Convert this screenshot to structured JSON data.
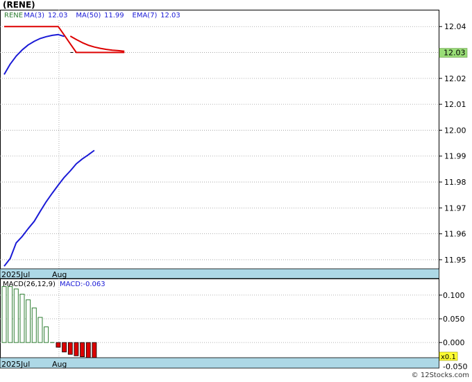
{
  "chart_data": [
    {
      "type": "line",
      "title": "(RENE)",
      "legend": [
        {
          "label": "RENE",
          "color": "#2e7d32"
        },
        {
          "label": "MA(3)",
          "value": "12.03",
          "color": "#1a1ad6"
        },
        {
          "label": "MA(50)",
          "value": "11.99",
          "color": "#1a1ad6"
        },
        {
          "label": "EMA(7)",
          "value": "12.03",
          "color": "#1a1ad6"
        }
      ],
      "x_labels": [
        "2025Jul",
        "Aug"
      ],
      "yticks": [
        11.95,
        11.96,
        11.97,
        11.98,
        11.99,
        12.0,
        12.01,
        12.02,
        12.03,
        12.04
      ],
      "ylim": [
        11.9465,
        12.0465
      ],
      "last_price_label": "12.03",
      "last_price_color": "#99dd77",
      "grid": true,
      "series": [
        {
          "key": "price",
          "color": "#000000",
          "dashed": true,
          "points": [
            [
              11,
              12.03
            ],
            [
              20,
              12.03
            ]
          ]
        },
        {
          "key": "ma3",
          "color": "#dd0000",
          "points": [
            [
              0,
              12.04
            ],
            [
              1,
              12.04
            ],
            [
              2,
              12.04
            ],
            [
              3,
              12.04
            ],
            [
              4,
              12.04
            ],
            [
              5,
              12.04
            ],
            [
              6,
              12.04
            ],
            [
              7,
              12.04
            ],
            [
              8,
              12.04
            ],
            [
              9,
              12.04
            ],
            [
              10,
              12.0367
            ],
            [
              11,
              12.0333
            ],
            [
              12,
              12.03
            ],
            [
              13,
              12.03
            ],
            [
              14,
              12.03
            ],
            [
              15,
              12.03
            ],
            [
              16,
              12.03
            ],
            [
              17,
              12.03
            ],
            [
              18,
              12.03
            ],
            [
              19,
              12.03
            ],
            [
              20,
              12.03
            ]
          ]
        },
        {
          "key": "ema7",
          "color": "#dd0000",
          "points": [
            [
              11,
              12.0363
            ],
            [
              12,
              12.035
            ],
            [
              13,
              12.0338
            ],
            [
              14,
              12.0328
            ],
            [
              15,
              12.0321
            ],
            [
              16,
              12.0316
            ],
            [
              17,
              12.0312
            ],
            [
              18,
              12.0309
            ],
            [
              19,
              12.0307
            ],
            [
              20,
              12.0305
            ]
          ]
        },
        {
          "key": "ma3_curve",
          "color": "#1a1ad6",
          "points": [
            [
              0,
              12.0215
            ],
            [
              1,
              12.0255
            ],
            [
              2,
              12.0286
            ],
            [
              3,
              12.031
            ],
            [
              4,
              12.0329
            ],
            [
              5,
              12.0343
            ],
            [
              6,
              12.0354
            ],
            [
              7,
              12.0361
            ],
            [
              8,
              12.0366
            ],
            [
              9,
              12.0369
            ],
            [
              10,
              12.0362
            ]
          ]
        },
        {
          "key": "ma50",
          "color": "#1a1ad6",
          "points": [
            [
              0,
              11.9475
            ],
            [
              1,
              11.9505
            ],
            [
              2,
              11.9565
            ],
            [
              3,
              11.959
            ],
            [
              4,
              11.962
            ],
            [
              5,
              11.9648
            ],
            [
              6,
              11.9687
            ],
            [
              7,
              11.9724
            ],
            [
              8,
              11.9757
            ],
            [
              9,
              11.9788
            ],
            [
              10,
              11.9818
            ],
            [
              11,
              11.9843
            ],
            [
              12,
              11.987
            ],
            [
              13,
              11.9889
            ],
            [
              14,
              11.9905
            ],
            [
              15,
              11.9922
            ]
          ]
        }
      ]
    },
    {
      "type": "bar",
      "title": "MACD(26,12,9)",
      "value_label": "MACD:-0.063",
      "x_labels": [
        "2025Jul",
        "Aug"
      ],
      "yticks": [
        -0.05,
        0.0,
        0.05,
        0.1
      ],
      "ytick_labels": [
        "-0.050",
        "0.000",
        "0.050",
        "0.100"
      ],
      "ylim": [
        -0.032,
        0.135
      ],
      "scale_label": "x0.1",
      "positive_color": "#2e7d32",
      "negative_color": "#dd0000",
      "values": [
        0.118,
        0.118,
        0.113,
        0.102,
        0.09,
        0.073,
        0.053,
        0.033,
        0.0,
        -0.01,
        -0.02,
        -0.025,
        -0.028,
        -0.03,
        -0.032,
        -0.032
      ]
    }
  ],
  "footer": {
    "text": "© 12Stocks.com"
  }
}
